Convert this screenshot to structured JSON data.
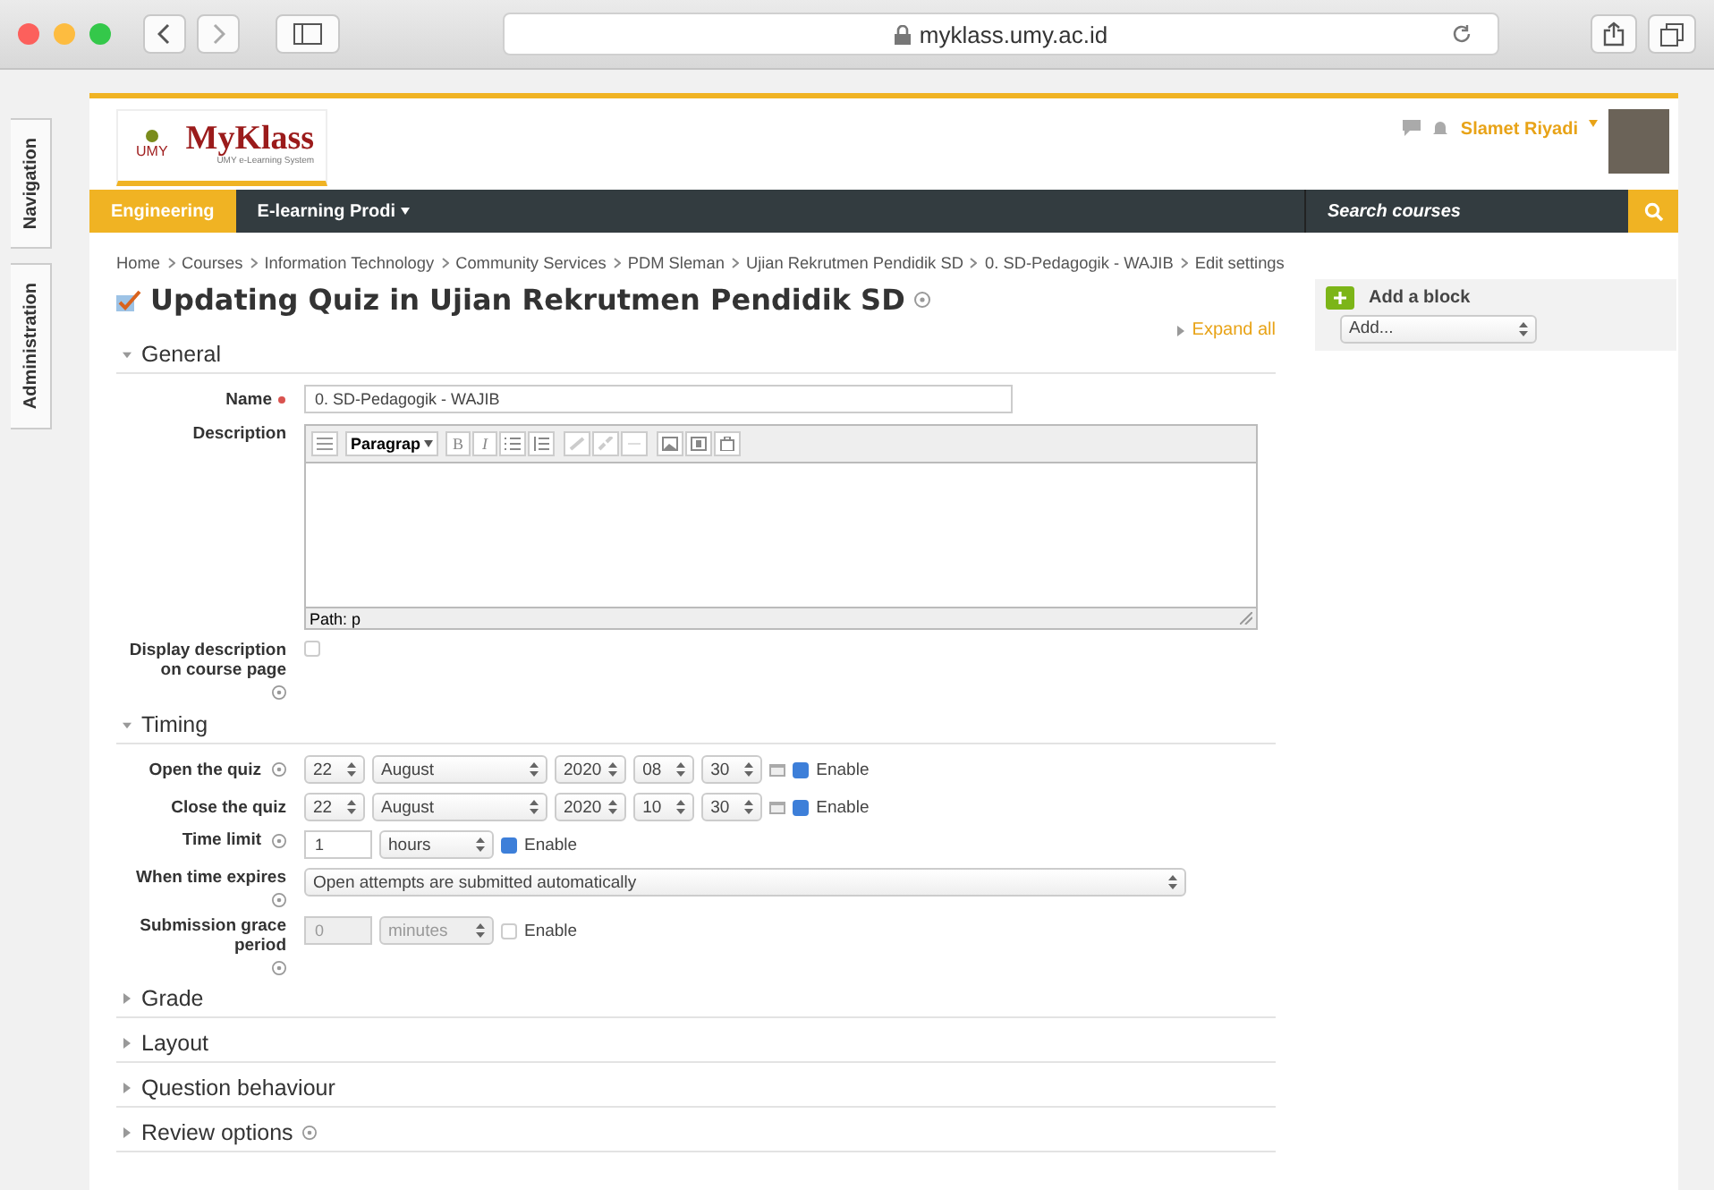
{
  "browser": {
    "url": "myklass.umy.ac.id"
  },
  "side_tabs": [
    {
      "label": "Navigation"
    },
    {
      "label": "Administration"
    }
  ],
  "header": {
    "logo_mark": "UMY",
    "logo_name": "MyKlass",
    "logo_tagline": "UMY e-Learning System",
    "user": "Slamet Riyadi"
  },
  "nav": {
    "items": [
      {
        "label": "Engineering",
        "selected": true,
        "menu": false
      },
      {
        "label": "E-learning Prodi",
        "selected": false,
        "menu": true
      }
    ],
    "search_placeholder": "Search courses"
  },
  "breadcrumb": [
    "Home",
    "Courses",
    "Information Technology",
    "Community Services",
    "PDM Sleman",
    "Ujian Rekrutmen Pendidik SD",
    "0. SD-Pedagogik - WAJIB",
    "Edit settings"
  ],
  "page_title": "Updating Quiz in Ujian Rekrutmen Pendidik SD",
  "expand_all": "Expand all",
  "general": {
    "title": "General",
    "expanded": true,
    "name_label": "Name",
    "name_value": "0. SD-Pedagogik - WAJIB",
    "required": true,
    "description_label": "Description",
    "format_menu": "Paragrap",
    "bold": "B",
    "italic": "I",
    "path": "Path: p",
    "display_label": "Display description on course page",
    "display_checked": false
  },
  "timing": {
    "title": "Timing",
    "expanded": true,
    "fields": [
      {
        "kind": "datetime",
        "label": "Open the quiz",
        "help": true,
        "day": "22",
        "month": "August",
        "year": "2020",
        "hour": "08",
        "minute": "30",
        "enable": "Enable",
        "enabled": true
      },
      {
        "kind": "datetime",
        "label": "Close the quiz",
        "help": false,
        "day": "22",
        "month": "August",
        "year": "2020",
        "hour": "10",
        "minute": "30",
        "enable": "Enable",
        "enabled": true
      },
      {
        "kind": "duration",
        "label": "Time limit",
        "help": true,
        "value": "1",
        "unit": "hours",
        "enable": "Enable",
        "enabled": true,
        "disabled": false
      },
      {
        "kind": "select",
        "label": "When time expires",
        "help": true,
        "value": "Open attempts are submitted automatically"
      },
      {
        "kind": "duration",
        "label": "Submission grace period",
        "help": true,
        "value": "0",
        "unit": "minutes",
        "enable": "Enable",
        "enabled": false,
        "disabled": true
      }
    ]
  },
  "collapsed_sections": [
    {
      "title": "Grade",
      "expanded": false,
      "help": false
    },
    {
      "title": "Layout",
      "expanded": false,
      "help": false
    },
    {
      "title": "Question behaviour",
      "expanded": false,
      "help": false
    },
    {
      "title": "Review options",
      "expanded": false,
      "help": true
    }
  ],
  "block": {
    "title": "Add a block",
    "select": "Add..."
  }
}
